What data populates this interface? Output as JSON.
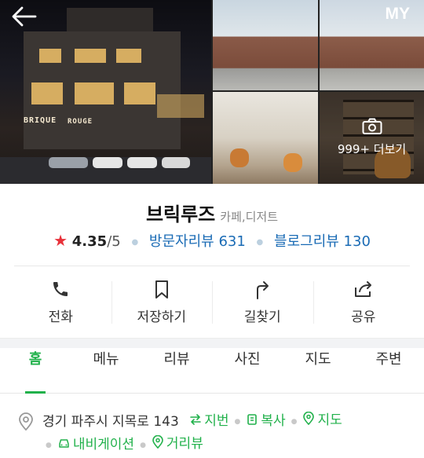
{
  "header": {
    "my_label": "MY"
  },
  "gallery": {
    "more_label": "999+ 더보기",
    "sign_main": "BRIQUE",
    "sign_second": "ROUGE"
  },
  "place": {
    "name": "브릭루즈",
    "category": "카페,디저트",
    "rating": "4.35",
    "rating_max": "/5",
    "visitor_reviews": "방문자리뷰 631",
    "blog_reviews": "블로그리뷰 130"
  },
  "actions": [
    {
      "label": "전화",
      "icon": "phone-icon"
    },
    {
      "label": "저장하기",
      "icon": "bookmark-icon"
    },
    {
      "label": "길찾기",
      "icon": "directions-icon"
    },
    {
      "label": "공유",
      "icon": "share-icon"
    }
  ],
  "tabs": [
    {
      "label": "홈",
      "active": true
    },
    {
      "label": "메뉴"
    },
    {
      "label": "리뷰"
    },
    {
      "label": "사진"
    },
    {
      "label": "지도"
    },
    {
      "label": "주변"
    }
  ],
  "address": {
    "text": "경기 파주시 지목로 143",
    "links": {
      "road_toggle": "지번",
      "copy": "복사",
      "map": "지도",
      "navigation": "내비게이션",
      "street_view": "거리뷰"
    }
  },
  "colors": {
    "accent": "#21b14b",
    "link_blue": "#1a6bb5",
    "star": "#e8313a"
  }
}
